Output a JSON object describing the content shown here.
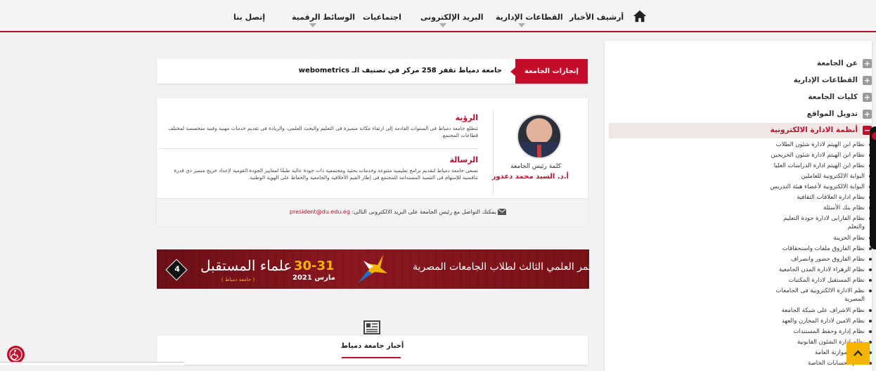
{
  "nav": {
    "items": [
      {
        "label": "أرشيف الأخبار"
      },
      {
        "label": "القطاعات الإدارية"
      },
      {
        "label": "البريد الإلكترونى"
      },
      {
        "label": "اجتماعيات"
      },
      {
        "label": "الوسائط الرقمية"
      },
      {
        "label": "إتصل بنا"
      }
    ]
  },
  "sidebar": {
    "headers": [
      {
        "label": "عن الجامعة"
      },
      {
        "label": "القطاعات الإدارية"
      },
      {
        "label": "كليات الجامعة"
      },
      {
        "label": "تدويل المواقع"
      },
      {
        "label": "أنظمة الادارة الالكترونية"
      }
    ],
    "subitems": [
      "نظام ابن الهيثم لادارة شئون الطلاب",
      "نظام ابن الهيثم لادارة شئون الخريجين",
      "نظام ابن الهيثم ادارة الدراسات العليا",
      "البوابة الالكترونية للعاملين",
      "البوابة الالكترونية لأعضاء هيئة التدريس",
      "نظام ادارة العلاقات الثقافية",
      "نظام بنك الأسئلة",
      "نظام الفارابى لادارة جودة التعليم",
      "والتعلم",
      "نظام الخزينة",
      "نظام الفاروق ملفات واستحقاقات",
      "نظام الفاروق حضور وانصراف",
      "نظام الزهراء لادارة المدن الجامعية",
      "نظام المستقبل لادارة المكتبات",
      "نظم الادارة الالكترونية فى الجامعات",
      "المصرية",
      "نظام الاشراف على شبكة الجامعة",
      "نظام الامين لادارة المخازن والعهد",
      "نظام إدارة وحفظ المستندات",
      "نظام ادارة الشئون القانونية",
      "نظام الموازنة العامة",
      "نظام الحسابات الخاصة"
    ]
  },
  "ticker": {
    "label": "إنجازات الجامعة",
    "text": "جامعة دمياط تقفز 258 مركز في تصنيف الـ webometrics"
  },
  "president": {
    "caption": "كلمة رئيس الجامعة",
    "name": "أ.د. السيد محمد دعدور",
    "vision_title": "الرؤية",
    "vision_text": "تتطلع جامعة دمياط فى السنوات القادمة إلى ارتقاء مكانة متميزة فى التعليم والبحث العلمى، والريادة فى تقديم خدمات مهنية وفنية متخصصة لمختلف قطاعات المجتمع.",
    "mission_title": "الرسالة",
    "mission_text": "تسعى جامعة دمياط لتقديم برامج تعليمية متنوعة وخدمات بحثية ومجتمعية ذات جودة عالية طبقًا لمعايير الجودة القومية لإعداد خريج متميز ذي قدرة تنافسية للإسهام فى التنمية المستدامة للمجتمع فى إطار القيم الأخلاقية والجامعية والحفاظ على الهوية الوطنية.",
    "contact_text": "يمكنك التواصل مع رئيس الجامعة على البريد الالكترونى التالى: ",
    "email": "president@du.edu.eg"
  },
  "banner": {
    "conference": "المؤتمر العلمي الثالث لطلاب الجامعات المصرية",
    "dates": "30-31",
    "month": "مارس 2021",
    "title": "علماء المستقبل",
    "subtitle": "( جامعة دمياط )",
    "number": "4"
  },
  "news": {
    "title": "أخبار جامعة دمياط"
  },
  "colors": {
    "brand_red": "#c40d2a",
    "accent_yellow": "#f5b400"
  }
}
